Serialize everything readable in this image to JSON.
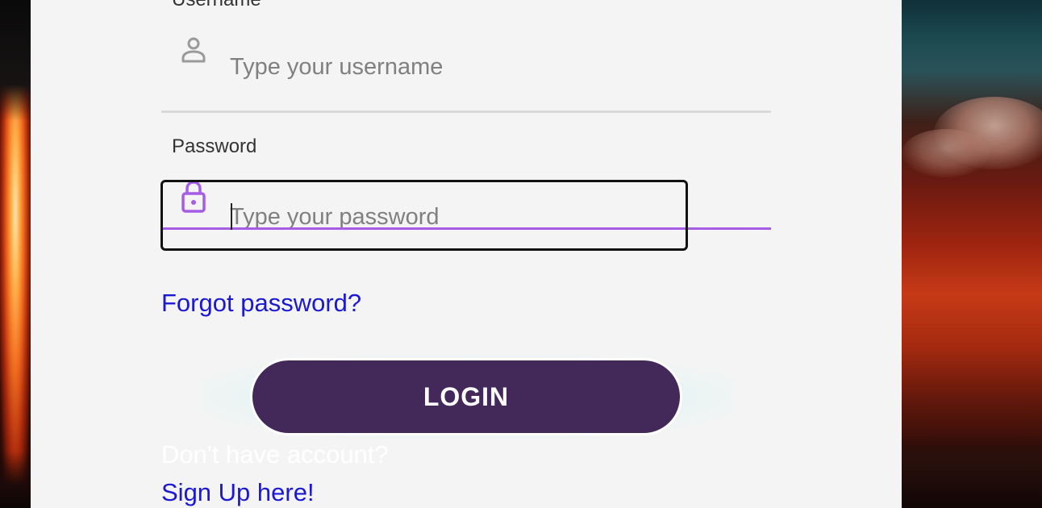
{
  "form": {
    "username_label": "Username",
    "username_placeholder": "Type your username",
    "password_label": "Password",
    "password_placeholder": "Type your password",
    "forgot_link": "Forgot password?",
    "login_button": "LOGIN",
    "no_account_text": "Don't have account?",
    "signup_link": "Sign Up here!"
  },
  "icons": {
    "username": "person-icon",
    "password": "lock-icon"
  },
  "colors": {
    "accent": "#a55de6",
    "button": "#43295a",
    "link": "#1a18d6",
    "card": "#f4f4f4"
  }
}
